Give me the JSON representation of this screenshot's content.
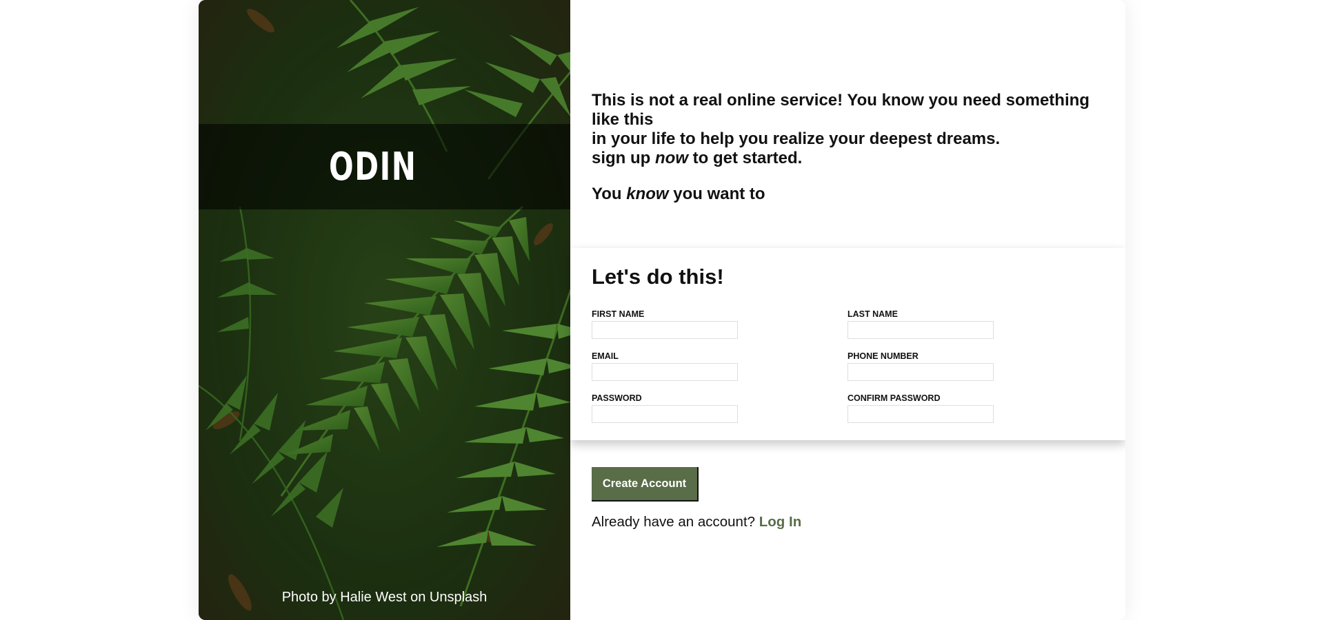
{
  "sidebar": {
    "logo_text": "ODIN",
    "logo_icon": "viking-helmet-icon",
    "photo_credit": "Photo by Halie West on Unsplash"
  },
  "intro": {
    "line1": "This is not a real online service! You know you need something like this",
    "line2": "in your life to help you realize your deepest dreams.",
    "line3_prefix": "sign up ",
    "line3_emph": "now",
    "line3_suffix": " to get started.",
    "line4_prefix": "You ",
    "line4_emph": "know",
    "line4_suffix": " you want to"
  },
  "form": {
    "title": "Let's do this!",
    "fields": {
      "first_name": {
        "label": "FIRST NAME",
        "value": ""
      },
      "last_name": {
        "label": "LAST NAME",
        "value": ""
      },
      "email": {
        "label": "EMAIL",
        "value": ""
      },
      "phone": {
        "label": "PHONE NUMBER",
        "value": ""
      },
      "password": {
        "label": "PASSWORD",
        "value": ""
      },
      "confirm_password": {
        "label": "CONFIRM PASSWORD",
        "value": ""
      }
    }
  },
  "actions": {
    "create_account_label": "Create Account",
    "login_prompt": "Already have an account? ",
    "login_link": "Log In"
  },
  "colors": {
    "accent": "#596d48",
    "text": "#111111"
  }
}
